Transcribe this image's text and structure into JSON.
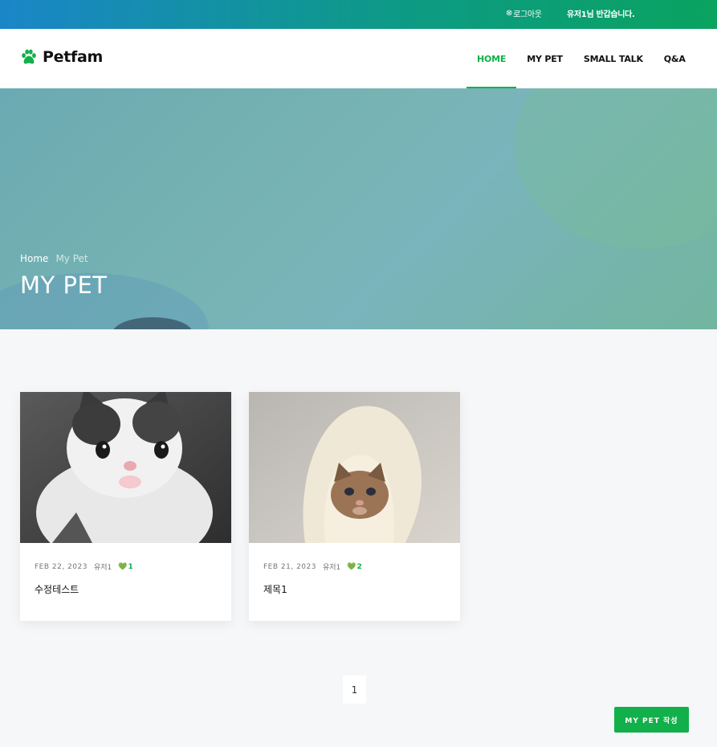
{
  "topbar": {
    "logout_label": "로그아웃",
    "welcome_text": "유저1님 반갑습니다."
  },
  "header": {
    "brand": "Petfam",
    "nav": [
      {
        "label": "HOME",
        "active": true
      },
      {
        "label": "MY PET",
        "active": false
      },
      {
        "label": "SMALL TALK",
        "active": false
      },
      {
        "label": "Q&A",
        "active": false
      }
    ]
  },
  "hero": {
    "breadcrumb": {
      "home": "Home",
      "current": "My Pet"
    },
    "title": "MY PET"
  },
  "posts": [
    {
      "date": "FEB 22, 2023",
      "author": "유저1",
      "likes": "1",
      "title": "수정테스트",
      "image": "kitten-gray-white-photo"
    },
    {
      "date": "FEB 21, 2023",
      "author": "유저1",
      "likes": "2",
      "title": "제목1",
      "image": "kitten-in-blanket-photo"
    }
  ],
  "pagination": {
    "current": "1"
  },
  "actions": {
    "write_label": "MY PET 작성"
  },
  "colors": {
    "accent": "#11b04a",
    "topbar_start": "#1a86c8",
    "topbar_end": "#0aa35f"
  }
}
